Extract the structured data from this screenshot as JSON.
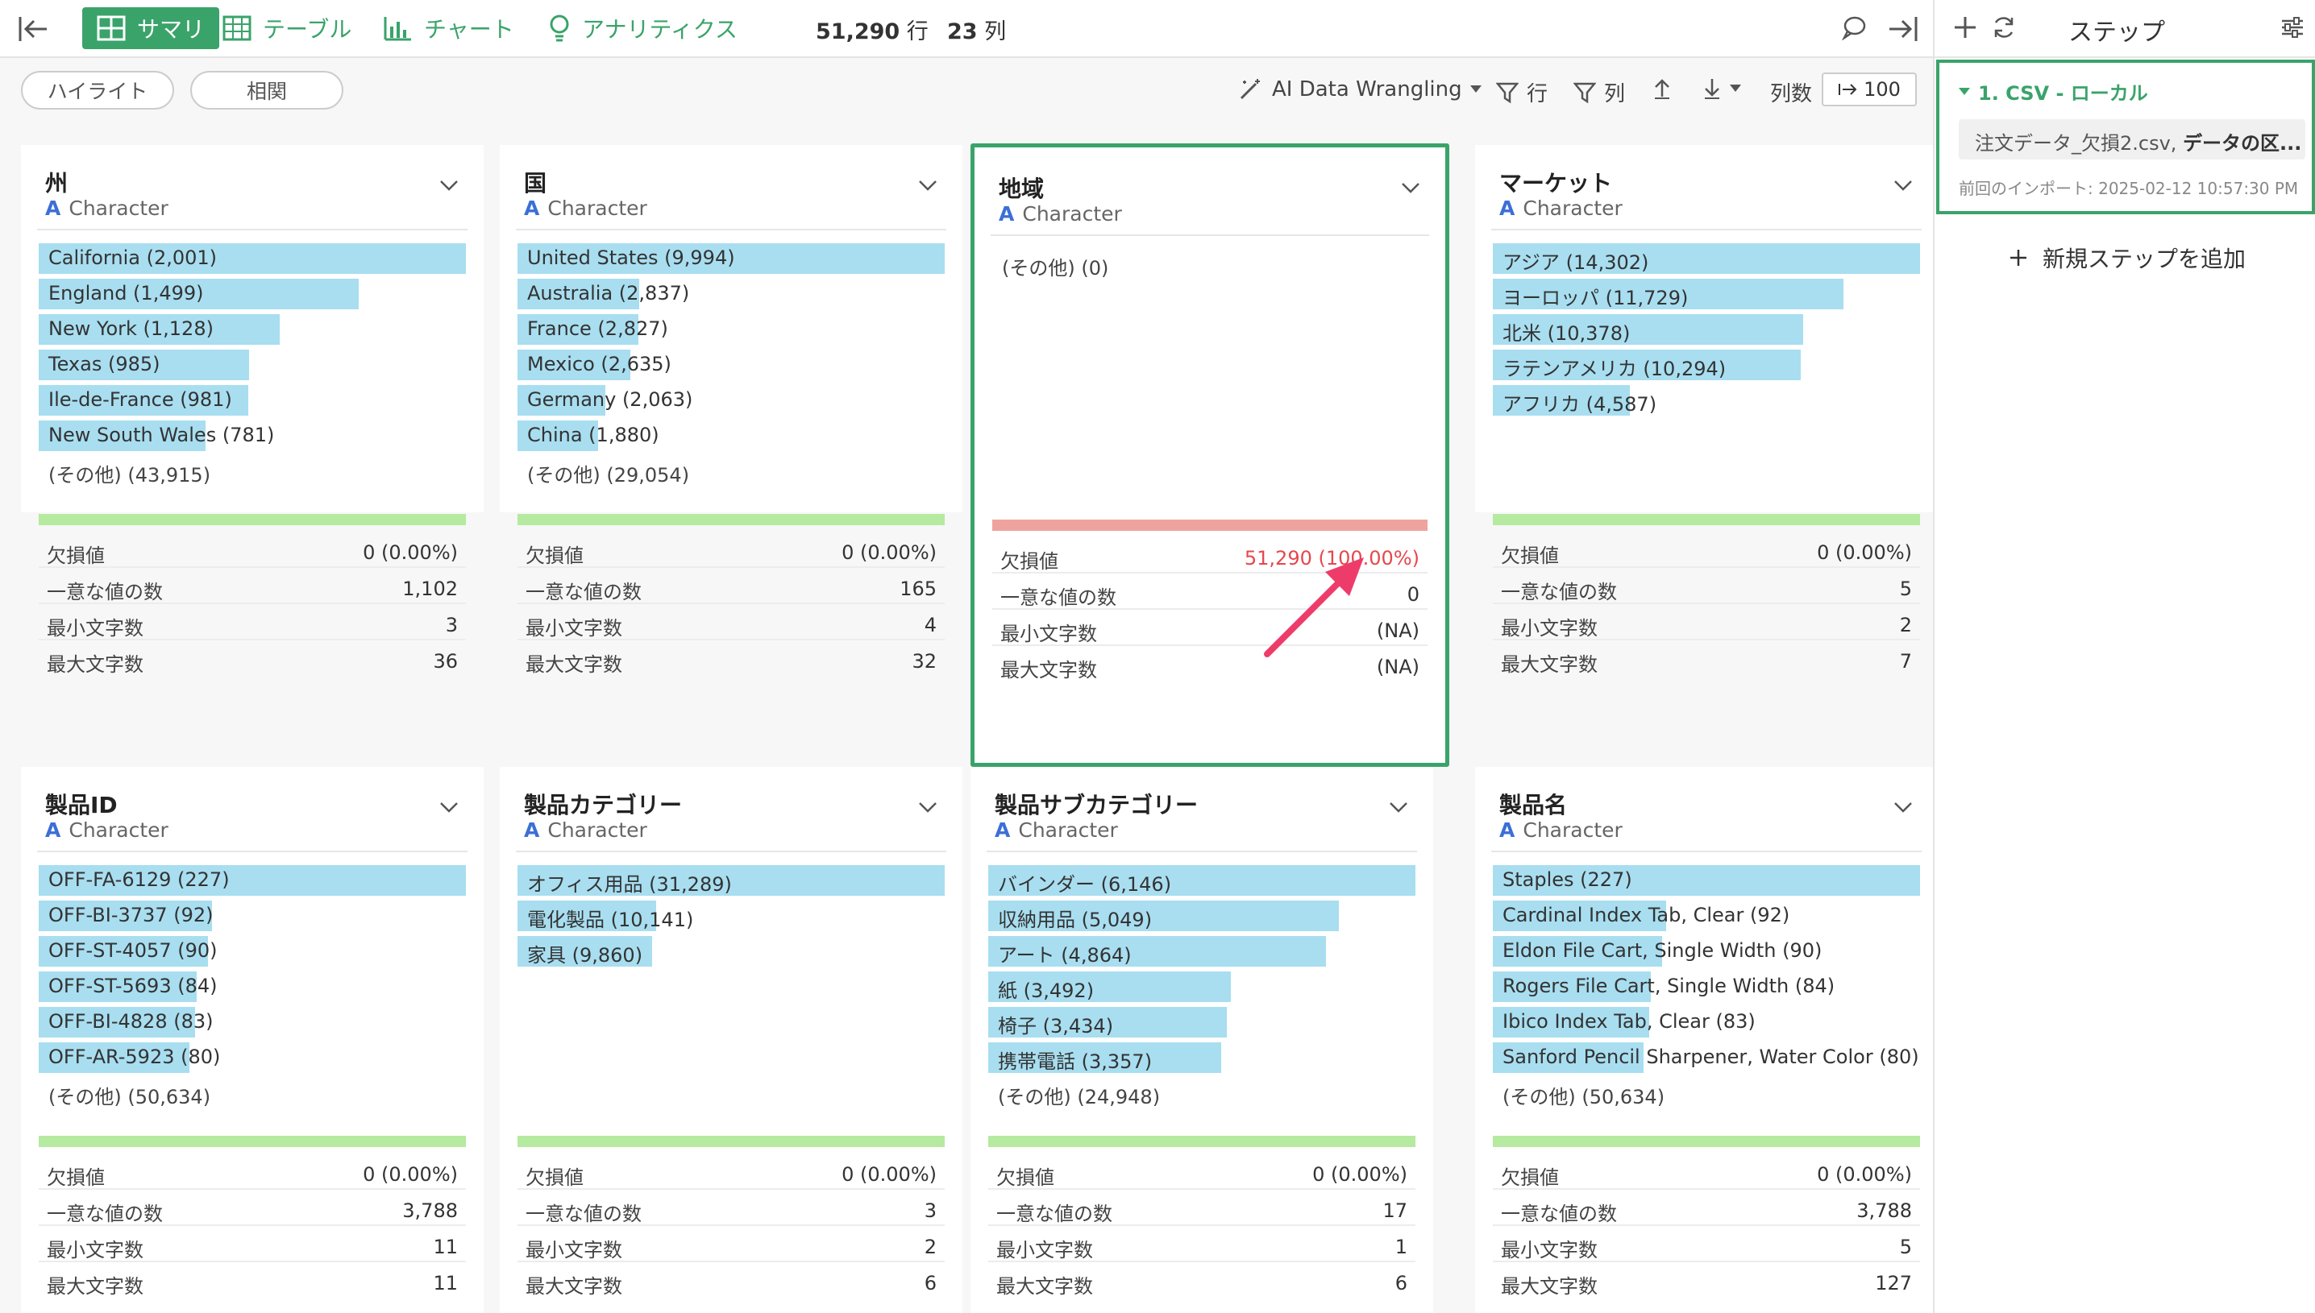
{
  "toolbar": {
    "tabs": [
      {
        "label": "サマリ",
        "icon": "grid-icon"
      },
      {
        "label": "テーブル",
        "icon": "table-icon"
      },
      {
        "label": "チャート",
        "icon": "bar-chart-icon"
      },
      {
        "label": "アナリティクス",
        "icon": "bulb-icon"
      }
    ],
    "rows_value": "51,290",
    "rows_unit": "行",
    "cols_value": "23",
    "cols_unit": "列"
  },
  "subbar": {
    "highlight_label": "ハイライト",
    "correlation_label": "相関",
    "ai_label": "AI Data Wrangling",
    "row_filter_label": "行",
    "col_filter_label": "列",
    "col_count_label": "列数",
    "col_count_value": "100"
  },
  "colors": {
    "accent": "#3aa36a",
    "bar": "#a8def0",
    "ok": "#b5eaa0",
    "missing": "#eea39f",
    "error": "#e5484d",
    "arrow": "#ee3c6a"
  },
  "cards": [
    {
      "title": "州",
      "type": "Character",
      "bars": [
        {
          "label": "California (2,001)",
          "fraction": 1.0
        },
        {
          "label": "England (1,499)",
          "fraction": 0.749
        },
        {
          "label": "New York (1,128)",
          "fraction": 0.564
        },
        {
          "label": "Texas (985)",
          "fraction": 0.492
        },
        {
          "label": "Ile-de-France (981)",
          "fraction": 0.49
        },
        {
          "label": "New South Wales (781)",
          "fraction": 0.39
        }
      ],
      "other": "(その他) (43,915)",
      "missing_ratio": 0,
      "stats": [
        {
          "k": "欠損値",
          "v": "0 (0.00%)"
        },
        {
          "k": "一意な値の数",
          "v": "1,102"
        },
        {
          "k": "最小文字数",
          "v": "3"
        },
        {
          "k": "最大文字数",
          "v": "36"
        }
      ]
    },
    {
      "title": "国",
      "type": "Character",
      "bars": [
        {
          "label": "United States (9,994)",
          "fraction": 1.0
        },
        {
          "label": "Australia (2,837)",
          "fraction": 0.284
        },
        {
          "label": "France (2,827)",
          "fraction": 0.283
        },
        {
          "label": "Mexico (2,635)",
          "fraction": 0.264
        },
        {
          "label": "Germany (2,063)",
          "fraction": 0.206
        },
        {
          "label": "China (1,880)",
          "fraction": 0.188
        }
      ],
      "other": "(その他) (29,054)",
      "missing_ratio": 0,
      "stats": [
        {
          "k": "欠損値",
          "v": "0 (0.00%)"
        },
        {
          "k": "一意な値の数",
          "v": "165"
        },
        {
          "k": "最小文字数",
          "v": "4"
        },
        {
          "k": "最大文字数",
          "v": "32"
        }
      ]
    },
    {
      "title": "地域",
      "type": "Character",
      "bars": [],
      "other": "(その他) (0)",
      "missing_ratio": 1,
      "stats": [
        {
          "k": "欠損値",
          "v": "51,290 (100.00%)",
          "red": true
        },
        {
          "k": "一意な値の数",
          "v": "0"
        },
        {
          "k": "最小文字数",
          "v": "(NA)"
        },
        {
          "k": "最大文字数",
          "v": "(NA)"
        }
      ]
    },
    {
      "title": "マーケット",
      "type": "Character",
      "bars": [
        {
          "label": "アジア (14,302)",
          "fraction": 1.0
        },
        {
          "label": "ヨーロッパ (11,729)",
          "fraction": 0.82
        },
        {
          "label": "北米 (10,378)",
          "fraction": 0.726
        },
        {
          "label": "ラテンアメリカ (10,294)",
          "fraction": 0.72
        },
        {
          "label": "アフリカ (4,587)",
          "fraction": 0.321
        }
      ],
      "other": "",
      "missing_ratio": 0,
      "stats": [
        {
          "k": "欠損値",
          "v": "0 (0.00%)"
        },
        {
          "k": "一意な値の数",
          "v": "5"
        },
        {
          "k": "最小文字数",
          "v": "2"
        },
        {
          "k": "最大文字数",
          "v": "7"
        }
      ]
    },
    {
      "title": "製品ID",
      "type": "Character",
      "bars": [
        {
          "label": "OFF-FA-6129 (227)",
          "fraction": 1.0
        },
        {
          "label": "OFF-BI-3737 (92)",
          "fraction": 0.405
        },
        {
          "label": "OFF-ST-4057 (90)",
          "fraction": 0.396
        },
        {
          "label": "OFF-ST-5693 (84)",
          "fraction": 0.37
        },
        {
          "label": "OFF-BI-4828 (83)",
          "fraction": 0.366
        },
        {
          "label": "OFF-AR-5923 (80)",
          "fraction": 0.352
        }
      ],
      "other": "(その他) (50,634)",
      "missing_ratio": 0,
      "stats": [
        {
          "k": "欠損値",
          "v": "0 (0.00%)"
        },
        {
          "k": "一意な値の数",
          "v": "3,788"
        },
        {
          "k": "最小文字数",
          "v": "11"
        },
        {
          "k": "最大文字数",
          "v": "11"
        }
      ]
    },
    {
      "title": "製品カテゴリー",
      "type": "Character",
      "bars": [
        {
          "label": "オフィス用品 (31,289)",
          "fraction": 1.0
        },
        {
          "label": "電化製品 (10,141)",
          "fraction": 0.324
        },
        {
          "label": "家具 (9,860)",
          "fraction": 0.315
        }
      ],
      "other": "",
      "missing_ratio": 0,
      "stats": [
        {
          "k": "欠損値",
          "v": "0 (0.00%)"
        },
        {
          "k": "一意な値の数",
          "v": "3"
        },
        {
          "k": "最小文字数",
          "v": "2"
        },
        {
          "k": "最大文字数",
          "v": "6"
        }
      ]
    },
    {
      "title": "製品サブカテゴリー",
      "type": "Character",
      "bars": [
        {
          "label": "バインダー (6,146)",
          "fraction": 1.0
        },
        {
          "label": "収納用品 (5,049)",
          "fraction": 0.821
        },
        {
          "label": "アート (4,864)",
          "fraction": 0.791
        },
        {
          "label": "紙 (3,492)",
          "fraction": 0.568
        },
        {
          "label": "椅子 (3,434)",
          "fraction": 0.559
        },
        {
          "label": "携帯電話 (3,357)",
          "fraction": 0.546
        }
      ],
      "other": "(その他) (24,948)",
      "missing_ratio": 0,
      "stats": [
        {
          "k": "欠損値",
          "v": "0 (0.00%)"
        },
        {
          "k": "一意な値の数",
          "v": "17"
        },
        {
          "k": "最小文字数",
          "v": "1"
        },
        {
          "k": "最大文字数",
          "v": "6"
        }
      ]
    },
    {
      "title": "製品名",
      "type": "Character",
      "bars": [
        {
          "label": "Staples (227)",
          "fraction": 1.0
        },
        {
          "label": "Cardinal Index Tab, Clear (92)",
          "fraction": 0.405
        },
        {
          "label": "Eldon File Cart, Single Width (90)",
          "fraction": 0.396
        },
        {
          "label": "Rogers File Cart, Single Width (84)",
          "fraction": 0.37
        },
        {
          "label": "Ibico Index Tab, Clear (83)",
          "fraction": 0.366
        },
        {
          "label": "Sanford Pencil Sharpener, Water Color (80)",
          "fraction": 0.352
        }
      ],
      "other": "(その他) (50,634)",
      "missing_ratio": 0,
      "stats": [
        {
          "k": "欠損値",
          "v": "0 (0.00%)"
        },
        {
          "k": "一意な値の数",
          "v": "3,788"
        },
        {
          "k": "最小文字数",
          "v": "5"
        },
        {
          "k": "最大文字数",
          "v": "127"
        }
      ]
    }
  ],
  "right_panel": {
    "title": "ステップ",
    "step_title": "1. CSV - ローカル",
    "step_file_prefix": "注文データ_欠損2.csv, ",
    "step_file_bold": "データの区...",
    "step_time": "前回のインポート: 2025-02-12 10:57:30 PM",
    "add_step_label": "新規ステップを追加"
  }
}
